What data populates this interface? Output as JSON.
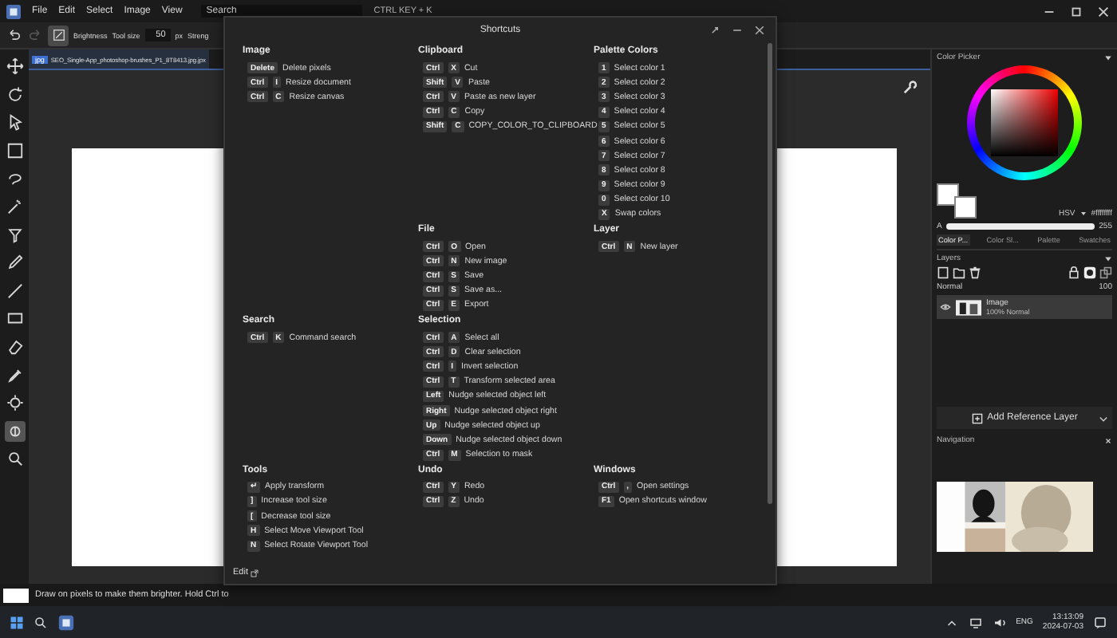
{
  "menu": {
    "items": [
      "File",
      "Edit",
      "Select",
      "Image",
      "View"
    ],
    "search": {
      "placeholder": "Search"
    },
    "hint": "CTRL KEY + K"
  },
  "toolbar": {
    "tool_name": "Brightness",
    "size_label": "Tool size",
    "size_value": "50",
    "size_unit": "px",
    "strength_label": "Streng"
  },
  "tools": [
    {
      "selected": false
    },
    {
      "selected": false
    },
    {
      "selected": false
    },
    {
      "selected": false
    },
    {
      "selected": false
    },
    {
      "selected": false
    },
    {
      "selected": false
    },
    {
      "selected": false
    },
    {
      "selected": false
    },
    {
      "selected": false
    },
    {
      "selected": false
    },
    {
      "selected": false
    },
    {
      "selected": false
    },
    {
      "selected": true
    },
    {
      "selected": false
    }
  ],
  "document_tab": {
    "badge": "jpg",
    "title": "SEO_Single-App_photoshop-brushes_P1_8T8413.jpg.jpx",
    "selected": true
  },
  "dialog": {
    "title": "Shortcuts",
    "footer": "Edit",
    "sections": [
      {
        "title": "Image",
        "items": [
          {
            "keys": [
              "Delete"
            ],
            "label": "Delete pixels"
          },
          {
            "keys": [
              "Ctrl",
              "I"
            ],
            "label": "Resize document"
          },
          {
            "keys": [
              "Ctrl",
              "C"
            ],
            "label": "Resize canvas"
          }
        ]
      },
      {
        "title": "Clipboard",
        "items": [
          {
            "keys": [
              "Ctrl",
              "X"
            ],
            "label": "Cut"
          },
          {
            "keys": [
              "Shift",
              "V"
            ],
            "label": "Paste"
          },
          {
            "keys": [
              "Ctrl",
              "V"
            ],
            "label": "Paste as new layer"
          },
          {
            "keys": [
              "Ctrl",
              "C"
            ],
            "label": "Copy"
          },
          {
            "keys": [
              "Shift",
              "C"
            ],
            "label": "COPY_COLOR_TO_CLIPBOARD"
          }
        ]
      },
      {
        "title": "Palette Colors",
        "items": [
          {
            "keys": [
              "1"
            ],
            "label": "Select color 1"
          },
          {
            "keys": [
              "2"
            ],
            "label": "Select color 2"
          },
          {
            "keys": [
              "3"
            ],
            "label": "Select color 3"
          },
          {
            "keys": [
              "4"
            ],
            "label": "Select color 4"
          },
          {
            "keys": [
              "5"
            ],
            "label": "Select color 5"
          },
          {
            "keys": [
              "6"
            ],
            "label": "Select color 6"
          },
          {
            "keys": [
              "7"
            ],
            "label": "Select color 7"
          },
          {
            "keys": [
              "8"
            ],
            "label": "Select color 8"
          },
          {
            "keys": [
              "9"
            ],
            "label": "Select color 9"
          },
          {
            "keys": [
              "0"
            ],
            "label": "Select color 10"
          },
          {
            "keys": [
              "X"
            ],
            "label": "Swap colors"
          }
        ]
      },
      {
        "title": "File",
        "items": [
          {
            "keys": [
              "Ctrl",
              "O"
            ],
            "label": "Open"
          },
          {
            "keys": [
              "Ctrl",
              "N"
            ],
            "label": "New image"
          },
          {
            "keys": [
              "Ctrl",
              "S"
            ],
            "label": "Save"
          },
          {
            "keys": [
              "Ctrl",
              "S"
            ],
            "label": "Save as..."
          },
          {
            "keys": [
              "Ctrl",
              "E"
            ],
            "label": "Export"
          }
        ]
      },
      {
        "title": "Layer",
        "items": [
          {
            "keys": [
              "Ctrl",
              "N"
            ],
            "label": "New layer"
          }
        ]
      },
      {
        "title": "Search",
        "items": [
          {
            "keys": [
              "Ctrl",
              "K"
            ],
            "label": "Command search"
          }
        ]
      },
      {
        "title": "Selection",
        "items": [
          {
            "keys": [
              "Ctrl",
              "A"
            ],
            "label": "Select all"
          },
          {
            "keys": [
              "Ctrl",
              "D"
            ],
            "label": "Clear selection"
          },
          {
            "keys": [
              "Ctrl",
              "I"
            ],
            "label": "Invert selection"
          },
          {
            "keys": [
              "Ctrl",
              "T"
            ],
            "label": "Transform selected area"
          },
          {
            "keys": [
              "Left"
            ],
            "label": "Nudge selected object left"
          },
          {
            "keys": [
              "Right"
            ],
            "label": "Nudge selected object right"
          },
          {
            "keys": [
              "Up"
            ],
            "label": "Nudge selected object up"
          },
          {
            "keys": [
              "Down"
            ],
            "label": "Nudge selected object down"
          },
          {
            "keys": [
              "Ctrl",
              "M"
            ],
            "label": "Selection to mask"
          }
        ]
      },
      {
        "title": "Tools",
        "items": [
          {
            "keys": [
              "↵"
            ],
            "label": "Apply transform"
          },
          {
            "keys": [
              "]"
            ],
            "label": "Increase tool size"
          },
          {
            "keys": [
              "["
            ],
            "label": "Decrease tool size"
          },
          {
            "keys": [
              "H"
            ],
            "label": "Select Move Viewport Tool"
          },
          {
            "keys": [
              "N"
            ],
            "label": "Select Rotate Viewport Tool"
          }
        ]
      },
      {
        "title": "Undo",
        "items": [
          {
            "keys": [
              "Ctrl",
              "Y"
            ],
            "label": "Redo"
          },
          {
            "keys": [
              "Ctrl",
              "Z"
            ],
            "label": "Undo"
          }
        ]
      },
      {
        "title": "Windows",
        "items": [
          {
            "keys": [
              "Ctrl",
              ","
            ],
            "label": "Open settings"
          },
          {
            "keys": [
              "F1"
            ],
            "label": "Open shortcuts window"
          }
        ]
      }
    ]
  },
  "color_picker": {
    "title": "Color Picker",
    "mode": "HSV",
    "hex": "#ffffffff",
    "alpha": {
      "label": "A",
      "level": 1,
      "reading": "255"
    },
    "tabs": [
      {
        "label": "Color P...",
        "selected": true
      },
      {
        "label": "Color Sl...",
        "selected": false
      },
      {
        "label": "Palette",
        "selected": false
      },
      {
        "label": "Swatches",
        "selected": false
      }
    ]
  },
  "layers": {
    "title": "Layers",
    "blend_mode": "Normal",
    "opacity": "100",
    "items": [
      {
        "name": "Image",
        "detail": "100% Normal",
        "selected": true
      }
    ]
  },
  "reference_button": "Add Reference Layer",
  "navigation": {
    "title": "Navigation"
  },
  "status": {
    "message": "Draw on pixels to make them brighter. Hold Ctrl to"
  },
  "taskbar": {
    "language": "ENG",
    "time": "13:13:09",
    "date": "2024-07-03"
  }
}
